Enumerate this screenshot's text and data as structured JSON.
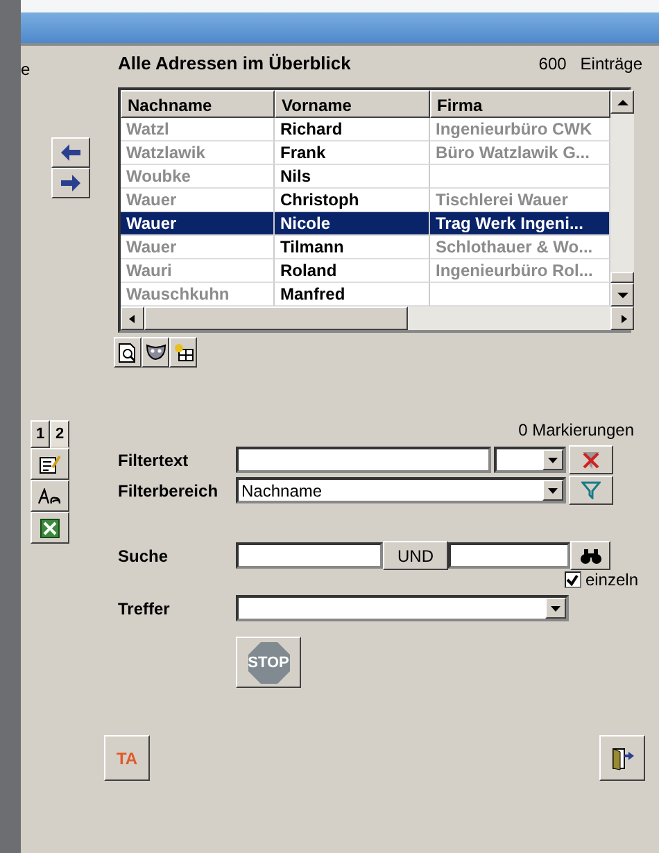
{
  "side_fragment": "e",
  "title": "Alle Adressen im Überblick",
  "count": "600",
  "count_label": "Einträge",
  "table": {
    "columns": [
      {
        "label": "Nachname",
        "faded": true
      },
      {
        "label": "Vorname",
        "faded": false
      },
      {
        "label": "Firma",
        "faded": true
      }
    ],
    "rows": [
      {
        "cells": [
          "Watzl",
          "Richard",
          "Ingenieurbüro CWK"
        ],
        "selected": false
      },
      {
        "cells": [
          "Watzlawik",
          "Frank",
          "Büro Watzlawik G..."
        ],
        "selected": false
      },
      {
        "cells": [
          "Woubke",
          "Nils",
          ""
        ],
        "selected": false
      },
      {
        "cells": [
          "Wauer",
          "Christoph",
          "Tischlerei Wauer"
        ],
        "selected": false
      },
      {
        "cells": [
          "Wauer",
          "Nicole",
          "Trag Werk Ingeni..."
        ],
        "selected": true
      },
      {
        "cells": [
          "Wauer",
          "Tilmann",
          "Schlothauer & Wo..."
        ],
        "selected": false
      },
      {
        "cells": [
          "Wauri",
          "Roland",
          "Ingenieurbüro Rol..."
        ],
        "selected": false
      },
      {
        "cells": [
          "Wauschkuhn",
          "Manfred",
          ""
        ],
        "selected": false
      }
    ]
  },
  "side_tabs": [
    {
      "label": "1",
      "selected": false
    },
    {
      "label": "2",
      "selected": true
    }
  ],
  "marks": "0 Markierungen",
  "filtertext": {
    "label": "Filtertext"
  },
  "filterbereich": {
    "label": "Filterbereich",
    "value": "Nachname"
  },
  "suche": {
    "label": "Suche",
    "operator": "UND",
    "einzeln": {
      "label": "einzeln",
      "checked": true
    }
  },
  "treffer": {
    "label": "Treffer"
  },
  "stop": "STOP",
  "ta": "TA"
}
